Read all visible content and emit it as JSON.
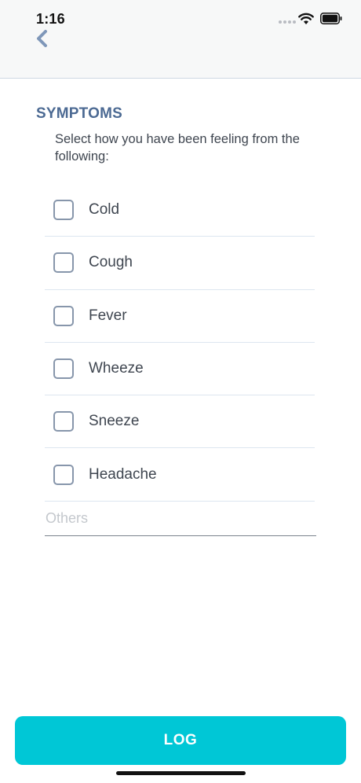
{
  "status_bar": {
    "time": "1:16",
    "icons": [
      "signal-dots-icon",
      "wifi-icon",
      "battery-icon"
    ]
  },
  "header": {
    "back_icon": "chevron-left-icon",
    "accent_color": "#7f97b9"
  },
  "section": {
    "title": "SYMPTOMS",
    "instruction": "Select how you have been feeling from the following:",
    "title_color": "#4c6a93"
  },
  "symptoms": [
    {
      "label": "Cold",
      "checked": false
    },
    {
      "label": "Cough",
      "checked": false
    },
    {
      "label": "Fever",
      "checked": false
    },
    {
      "label": "Wheeze",
      "checked": false
    },
    {
      "label": "Sneeze",
      "checked": false
    },
    {
      "label": "Headache",
      "checked": false
    }
  ],
  "others": {
    "placeholder": "Others",
    "value": ""
  },
  "footer": {
    "log_label": "LOG",
    "button_color": "#00c7d6"
  }
}
